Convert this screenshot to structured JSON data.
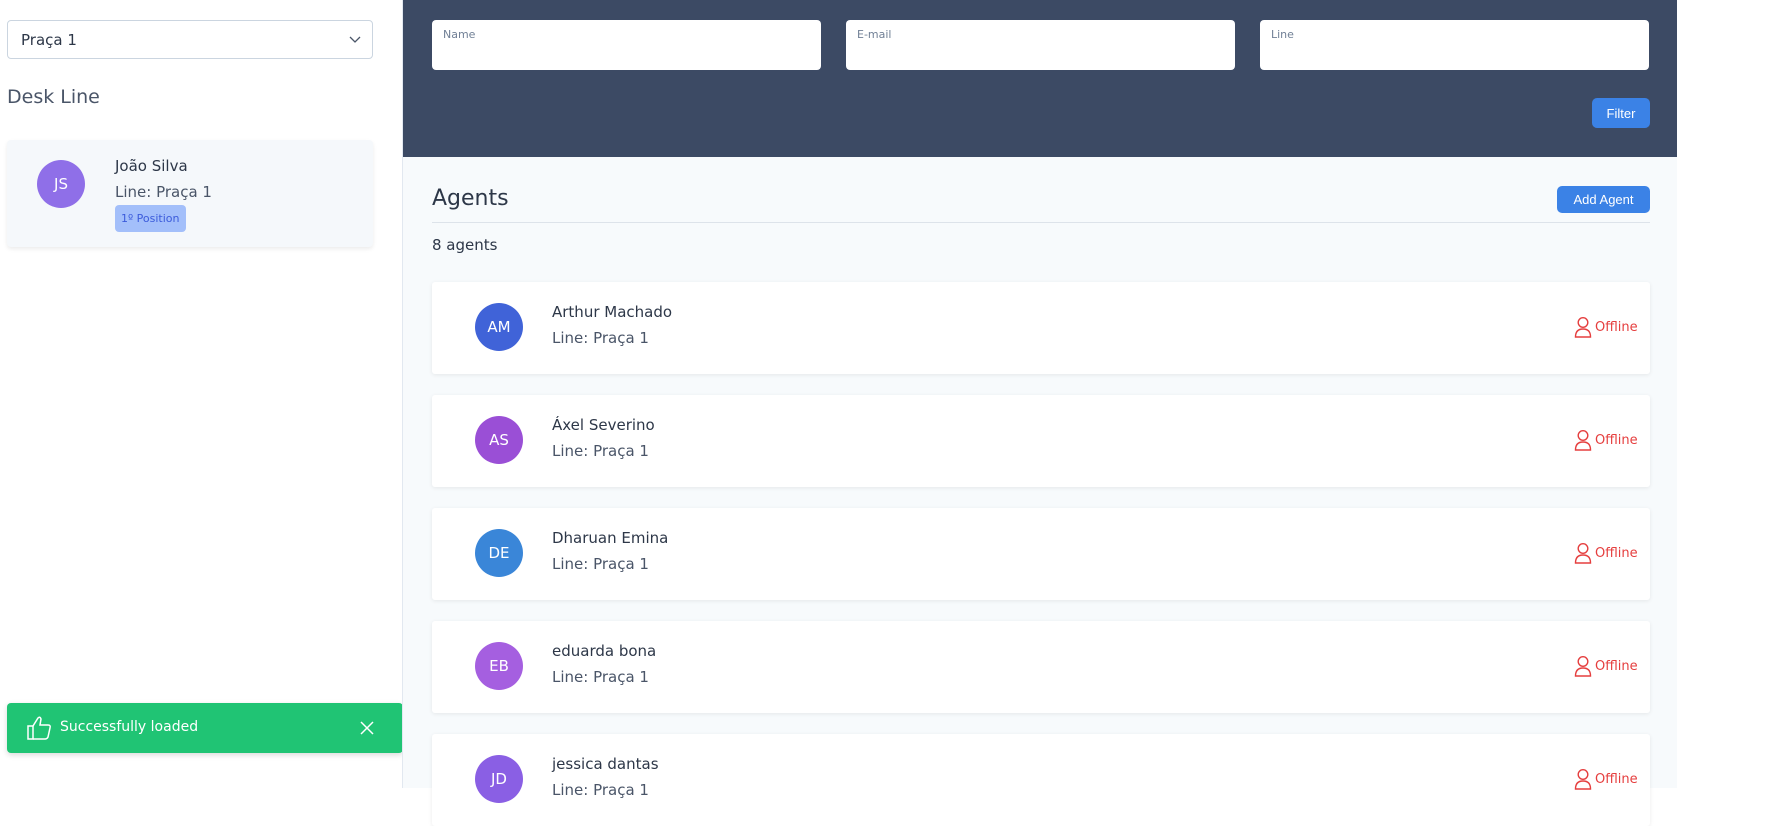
{
  "sidebar": {
    "line_select": {
      "value": "Praça 1",
      "icon": "chevron-down-icon"
    },
    "desk_title": "Desk Line",
    "desk_agent": {
      "initials": "JS",
      "name": "João Silva",
      "line": "Line: Praça 1",
      "badge": "1º Position",
      "avatar_color": "#8f6fe8"
    }
  },
  "toast": {
    "message": "Successfully loaded",
    "icon": "thumbs-up-icon",
    "close_icon": "close-icon",
    "color": "#20c474"
  },
  "filters": {
    "name_label": "Name",
    "email_label": "E-mail",
    "line_label": "Line",
    "filter_button": "Filter"
  },
  "agents": {
    "title": "Agents",
    "add_button": "Add Agent",
    "count": "8 agents",
    "list": [
      {
        "initials": "AM",
        "name": "Arthur Machado",
        "line": "Line: Praça 1",
        "status": "Offline",
        "color": "#4063d8"
      },
      {
        "initials": "AS",
        "name": "Áxel Severino",
        "line": "Line: Praça 1",
        "status": "Offline",
        "color": "#9a4fd6"
      },
      {
        "initials": "DE",
        "name": "Dharuan Emina",
        "line": "Line: Praça 1",
        "status": "Offline",
        "color": "#3a86d8"
      },
      {
        "initials": "EB",
        "name": "eduarda bona",
        "line": "Line: Praça 1",
        "status": "Offline",
        "color": "#a55fe0"
      },
      {
        "initials": "JD",
        "name": "jessica dantas",
        "line": "Line: Praça 1",
        "status": "Offline",
        "color": "#8a5fe4"
      }
    ]
  },
  "colors": {
    "header_bg": "#3c4a64",
    "primary": "#3b82e6",
    "offline": "#e53e3e"
  }
}
